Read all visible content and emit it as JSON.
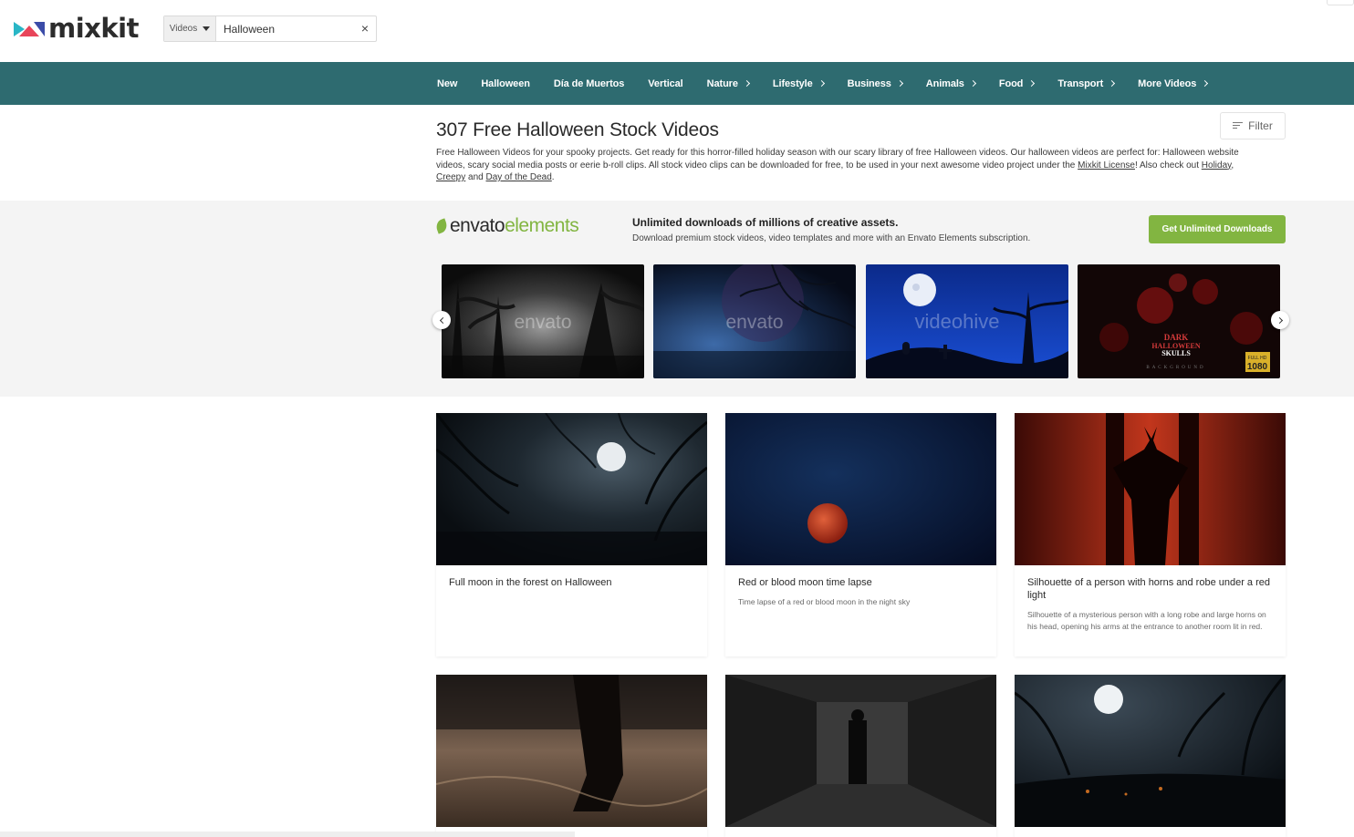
{
  "header": {
    "logo_text": "mixkit",
    "search_type": "Videos",
    "search_value": "Halloween",
    "clear_icon": "×"
  },
  "nav": {
    "items": [
      {
        "label": "New",
        "has_chevron": false
      },
      {
        "label": "Halloween",
        "has_chevron": false
      },
      {
        "label": "Día de Muertos",
        "has_chevron": false
      },
      {
        "label": "Vertical",
        "has_chevron": false
      },
      {
        "label": "Nature",
        "has_chevron": true
      },
      {
        "label": "Lifestyle",
        "has_chevron": true
      },
      {
        "label": "Business",
        "has_chevron": true
      },
      {
        "label": "Animals",
        "has_chevron": true
      },
      {
        "label": "Food",
        "has_chevron": true
      },
      {
        "label": "Transport",
        "has_chevron": true
      },
      {
        "label": "More Videos",
        "has_chevron": true
      }
    ]
  },
  "page": {
    "title": "307 Free Halloween Stock Videos",
    "filter_label": "Filter",
    "intro_text": "Free Halloween Videos for your spooky projects. Get ready for this horror-filled holiday season with our scary library of free Halloween videos. Our halloween videos are perfect for: Halloween website videos, scary social media posts or eerie b-roll clips. All stock video clips can be downloaded for free, to be used in your next awesome video project under the ",
    "license_link": "Mixkit License",
    "also_text": "! Also check out ",
    "links": [
      "Holiday",
      "Creepy",
      "Day of the Dead"
    ],
    "sep1": ", ",
    "sep2": " and ",
    "end": "."
  },
  "envato": {
    "logo_part1": "envato",
    "logo_part2": "elements",
    "headline": "Unlimited downloads of millions of creative assets.",
    "subline": "Download premium stock videos, video templates and more with an Envato Elements subscription.",
    "cta_label": "Get Unlimited Downloads",
    "tiles": [
      {
        "watermark": "envato"
      },
      {
        "watermark": "envato"
      },
      {
        "watermark": "videohive"
      },
      {
        "title_line1": "DARK",
        "title_line2": "HALLOWEEN",
        "title_line3": "SKULLS",
        "sub": "BACKGROUND",
        "badge_top": "FULL HD",
        "badge_num": "1080"
      }
    ]
  },
  "videos": [
    {
      "title": "Full moon in the forest on Halloween",
      "description": ""
    },
    {
      "title": "Red or blood moon time lapse",
      "description": "Time lapse of a red or blood moon in the night sky"
    },
    {
      "title": "Silhouette of a person with horns and robe under a red light",
      "description": "Silhouette of a mysterious person with a long robe and large horns on his head, opening his arms at the entrance to another room lit in red."
    },
    {
      "title": "",
      "description": ""
    },
    {
      "title": "",
      "description": ""
    },
    {
      "title": "",
      "description": ""
    }
  ],
  "colors": {
    "nav_bg": "#2e6b70",
    "envato_green": "#82b541",
    "band_bg": "#f4f4f4"
  }
}
